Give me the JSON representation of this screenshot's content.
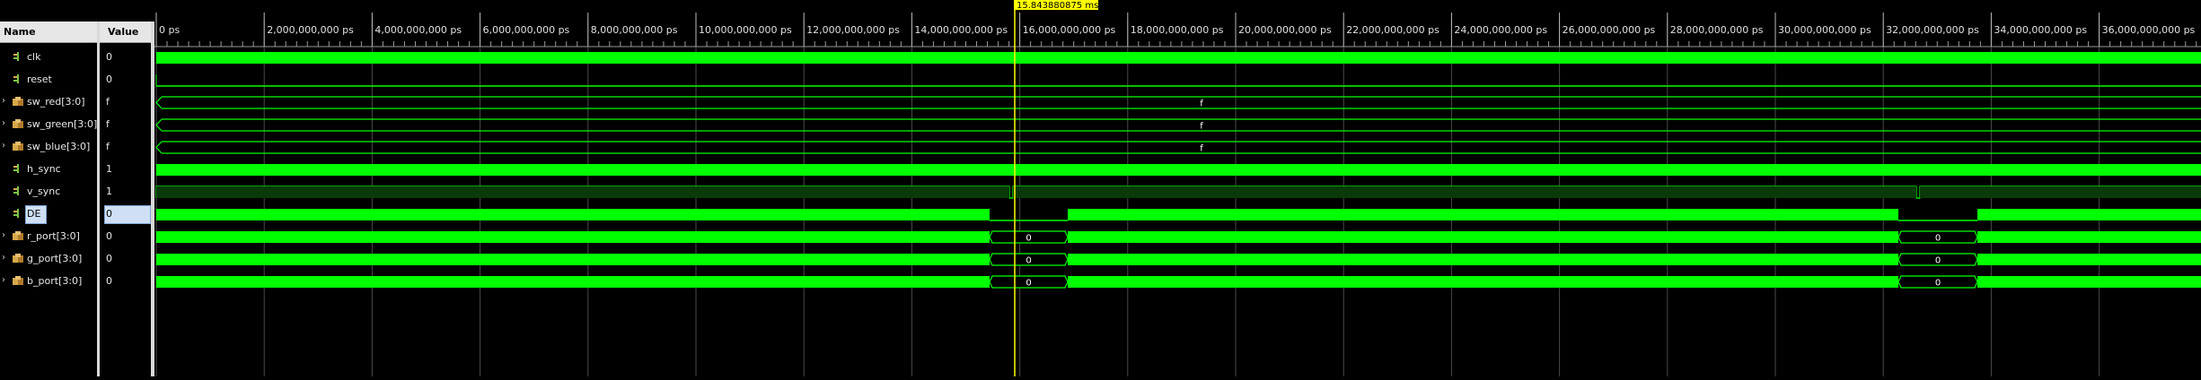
{
  "headers": {
    "name": "Name",
    "value": "Value"
  },
  "cursor": {
    "time_label": "15.843880875 ms"
  },
  "ruler": {
    "labels": [
      "0 ps",
      "2,000,000,000 ps",
      "4,000,000,000 ps",
      "6,000,000,000 ps",
      "8,000,000,000 ps",
      "10,000,000,000 ps",
      "12,000,000,000 ps",
      "14,000,000,000 ps",
      "16,000,000,000 ps",
      "18,000,000,000 ps",
      "20,000,000,000 ps",
      "22,000,000,000 ps",
      "24,000,000,000 ps",
      "26,000,000,000 ps",
      "28,000,000,000 ps",
      "30,000,000,000 ps",
      "32,000,000,000 ps",
      "34,000,000,000 ps",
      "36,000,000,000 ps"
    ]
  },
  "signals": [
    {
      "id": "clk",
      "name": "clk",
      "value": "0",
      "type": "bit",
      "expandable": false,
      "selected": false,
      "wave": "fast"
    },
    {
      "id": "reset",
      "name": "reset",
      "value": "0",
      "type": "bit",
      "expandable": false,
      "selected": false,
      "wave": "low"
    },
    {
      "id": "sw-red",
      "name": "sw_red[3:0]",
      "value": "f",
      "type": "bus",
      "expandable": true,
      "selected": false,
      "wave": "bus",
      "bus_label": "f"
    },
    {
      "id": "sw-green",
      "name": "sw_green[3:0]",
      "value": "f",
      "type": "bus",
      "expandable": true,
      "selected": false,
      "wave": "bus",
      "bus_label": "f"
    },
    {
      "id": "sw-blue",
      "name": "sw_blue[3:0]",
      "value": "f",
      "type": "bus",
      "expandable": true,
      "selected": false,
      "wave": "bus",
      "bus_label": "f"
    },
    {
      "id": "h-sync",
      "name": "h_sync",
      "value": "1",
      "type": "bit",
      "expandable": false,
      "selected": false,
      "wave": "fast"
    },
    {
      "id": "v-sync",
      "name": "v_sync",
      "value": "1",
      "type": "bit",
      "expandable": false,
      "selected": false,
      "wave": "vsync"
    },
    {
      "id": "de",
      "name": "DE",
      "value": "0",
      "type": "bit",
      "expandable": false,
      "selected": true,
      "wave": "de"
    },
    {
      "id": "r-port",
      "name": "r_port[3:0]",
      "value": "0",
      "type": "bus",
      "expandable": true,
      "selected": false,
      "wave": "port",
      "gap_label": "0"
    },
    {
      "id": "g-port",
      "name": "g_port[3:0]",
      "value": "0",
      "type": "bus",
      "expandable": true,
      "selected": false,
      "wave": "port",
      "gap_label": "0"
    },
    {
      "id": "b-port",
      "name": "b_port[3:0]",
      "value": "0",
      "type": "bus",
      "expandable": true,
      "selected": false,
      "wave": "port",
      "gap_label": "0"
    }
  ],
  "colors": {
    "wave": "#00ff00",
    "cursor": "#ffff00",
    "grid": "#4a4a4a",
    "selection": "#cfe0f6"
  }
}
